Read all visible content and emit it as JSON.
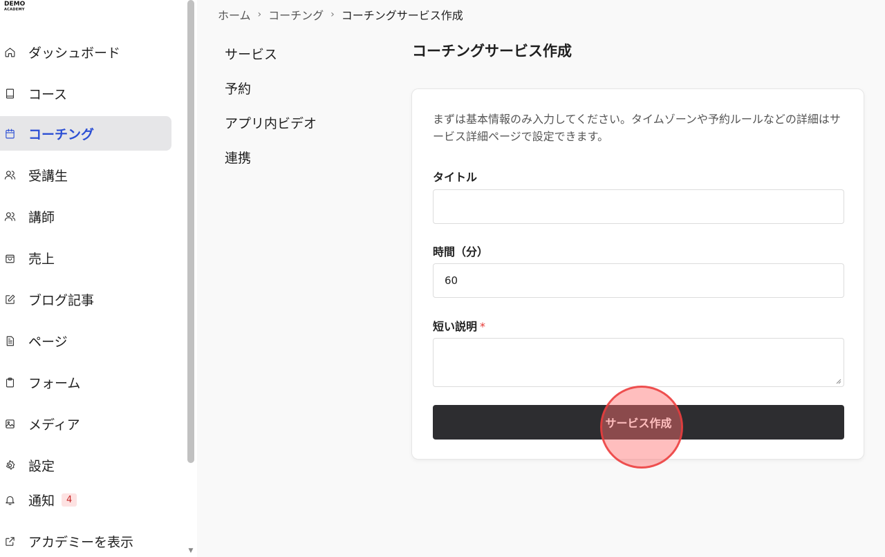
{
  "logo": {
    "line1": "DEMO",
    "line2": "ACADEMY"
  },
  "sidebar": {
    "items": [
      {
        "label": "ダッシュボード",
        "icon": "home-icon"
      },
      {
        "label": "コース",
        "icon": "book-icon"
      },
      {
        "label": "コーチング",
        "icon": "calendar-icon",
        "active": true
      },
      {
        "label": "受講生",
        "icon": "users-icon"
      },
      {
        "label": "講師",
        "icon": "users-icon"
      },
      {
        "label": "売上",
        "icon": "bag-icon"
      },
      {
        "label": "ブログ記事",
        "icon": "edit-icon"
      },
      {
        "label": "ページ",
        "icon": "file-icon"
      },
      {
        "label": "フォーム",
        "icon": "clipboard-icon"
      },
      {
        "label": "メディア",
        "icon": "image-icon"
      },
      {
        "label": "設定",
        "icon": "gear-icon"
      },
      {
        "label": "通知",
        "icon": "bell-icon",
        "badge": "4"
      },
      {
        "label": "アカデミーを表示",
        "icon": "external-link-icon"
      }
    ]
  },
  "breadcrumb": {
    "home": "ホーム",
    "section": "コーチング",
    "current": "コーチングサービス作成",
    "separator": "›"
  },
  "subnav": {
    "items": [
      "サービス",
      "予約",
      "アプリ内ビデオ",
      "連携"
    ]
  },
  "main": {
    "title": "コーチングサービス作成",
    "intro": "まずは基本情報のみ入力してください。タイムゾーンや予約ルールなどの詳細はサービス詳細ページで設定できます。",
    "fields": {
      "title_label": "タイトル",
      "title_value": "",
      "duration_label": "時間（分）",
      "duration_value": "60",
      "description_label": "短い説明",
      "description_required": "*",
      "description_value": ""
    },
    "submit_label": "サービス作成"
  },
  "colors": {
    "accent": "#2c4fd4",
    "button": "#2d2d30",
    "required": "#e53935",
    "badge_bg": "#fde2e2"
  }
}
